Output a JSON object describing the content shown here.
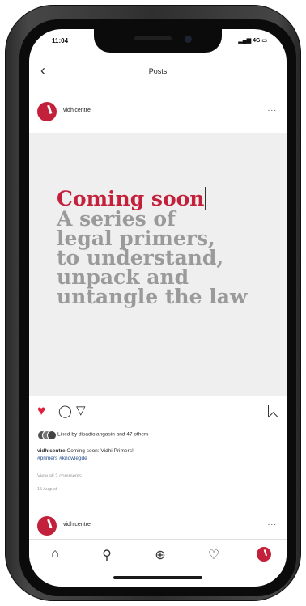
{
  "status_bar": {
    "time": "11:04",
    "signal": "4G"
  },
  "nav": {
    "back_icon": "chevron-left-icon",
    "title": "Posts"
  },
  "post": {
    "username": "vidhicentre",
    "more": "...",
    "image_text": {
      "highlight": "Coming soon",
      "lines": [
        "A series of",
        "legal primers,",
        "to understand,",
        "unpack and",
        "untangle the law"
      ]
    },
    "likes_text": "Liked by disadiolangasin and 47 others",
    "caption_user": "vidhicentre",
    "caption_text": "Coming soon: Vidhi Primers!",
    "hashtags": "#primers #knowlegde",
    "view_comments": "View all 2 comments",
    "date": "15 August"
  },
  "next_post": {
    "username": "vidhicentre",
    "more": "..."
  },
  "tabbar": {
    "home": "⌂",
    "search": "⚲",
    "add": "⊕",
    "activity": "♡"
  },
  "colors": {
    "brand": "#c3213b",
    "like": "#e01f3a",
    "primer_text": "#9a9a9a"
  }
}
